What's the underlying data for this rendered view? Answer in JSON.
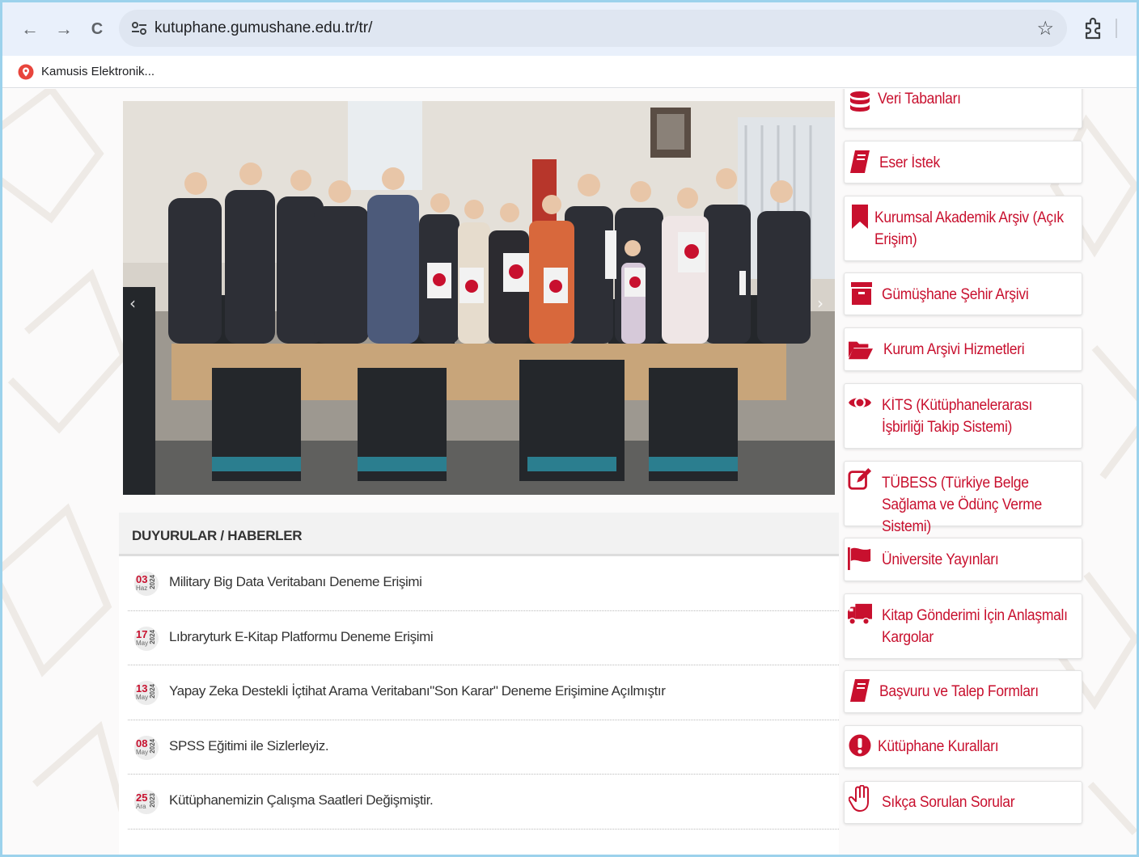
{
  "browser": {
    "back_label": "←",
    "forward_label": "→",
    "reload_label": "C",
    "url": "kutuphane.gumushane.edu.tr/tr/",
    "star_label": "☆",
    "bookmark_label": "Kamusis Elektronik..."
  },
  "slider": {
    "prev_label": "‹",
    "next_label": "›"
  },
  "news": {
    "heading": "DUYURULAR / HABERLER",
    "items": [
      {
        "day": "03",
        "month": "Haz",
        "year": "2024",
        "title": "Military Big Data Veritabanı Deneme Erişimi"
      },
      {
        "day": "17",
        "month": "May",
        "year": "2024",
        "title": "Lıbraryturk E-Kitap Platformu Deneme Erişimi"
      },
      {
        "day": "13",
        "month": "May",
        "year": "2024",
        "title": "Yapay Zeka Destekli İçtihat Arama Veritabanı\"Son Karar\" Deneme Erişimine Açılmıştır"
      },
      {
        "day": "08",
        "month": "May",
        "year": "2024",
        "title": "SPSS Eğitimi ile Sizlerleyiz."
      },
      {
        "day": "25",
        "month": "Ara",
        "year": "2023",
        "title": "Kütüphanemizin Çalışma Saatleri Değişmiştir."
      }
    ]
  },
  "sidebar": {
    "accent": "#c8102e",
    "items": [
      {
        "icon": "database-icon",
        "label": "Veri Tabanları"
      },
      {
        "icon": "book-icon",
        "label": "Eser İstek"
      },
      {
        "icon": "bookmark-icon",
        "label": "Kurumsal Akademik Arşiv (Açık Erişim)"
      },
      {
        "icon": "archive-icon",
        "label": "Gümüşhane Şehir Arşivi"
      },
      {
        "icon": "folder-open-icon",
        "label": "Kurum Arşivi Hizmetleri"
      },
      {
        "icon": "eye-icon",
        "label": "KİTS (Kütüphanelerarası İşbirliği Takip Sistemi)"
      },
      {
        "icon": "edit-icon",
        "label": "TÜBESS (Türkiye Belge Sağlama ve Ödünç Verme Sistemi)"
      },
      {
        "icon": "flag-icon",
        "label": "Üniversite Yayınları"
      },
      {
        "icon": "truck-icon",
        "label": "Kitap Gönderimi İçin Anlaşmalı Kargolar"
      },
      {
        "icon": "book-icon",
        "label": "Başvuru ve Talep Formları"
      },
      {
        "icon": "exclamation-icon",
        "label": "Kütüphane Kuralları"
      },
      {
        "icon": "hand-icon",
        "label": "Sıkça Sorulan Sorular"
      }
    ]
  }
}
